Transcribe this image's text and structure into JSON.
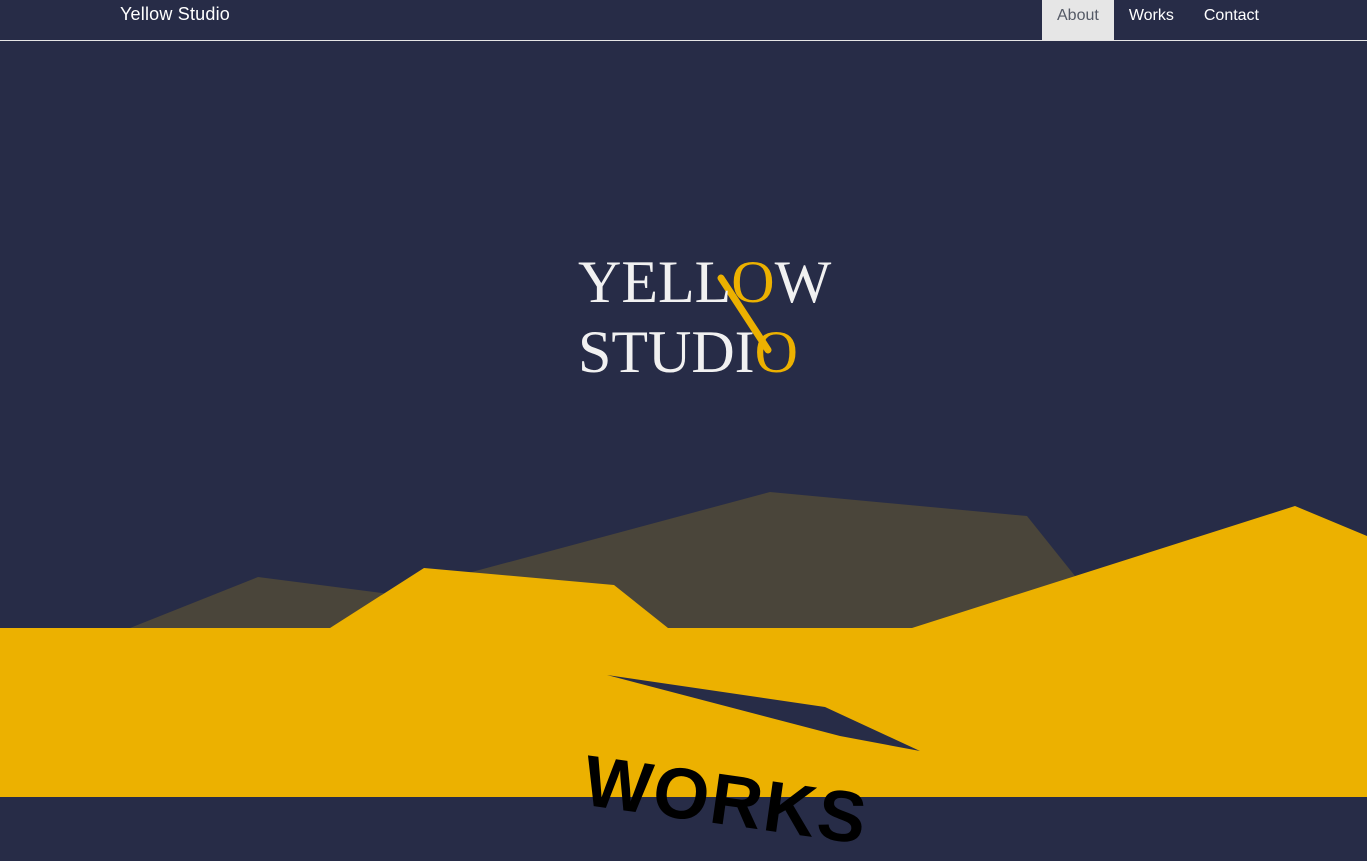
{
  "navbar": {
    "brand": "Yellow Studio",
    "links": [
      {
        "label": "About",
        "active": true
      },
      {
        "label": "Works",
        "active": false
      },
      {
        "label": "Contact",
        "active": false
      }
    ]
  },
  "hero": {
    "logo_line1_prefix": "YELL",
    "logo_line1_o": "O",
    "logo_line1_suffix": "W",
    "logo_line2_prefix": "STUDI",
    "logo_line2_o": "O"
  },
  "works": {
    "title": "WORKS"
  },
  "colors": {
    "background": "#272c47",
    "accent_yellow": "#ecb100",
    "mountain_brown": "#4a453a",
    "logo_white": "#f1f1f1",
    "nav_active_bg": "#e6e6e6"
  }
}
